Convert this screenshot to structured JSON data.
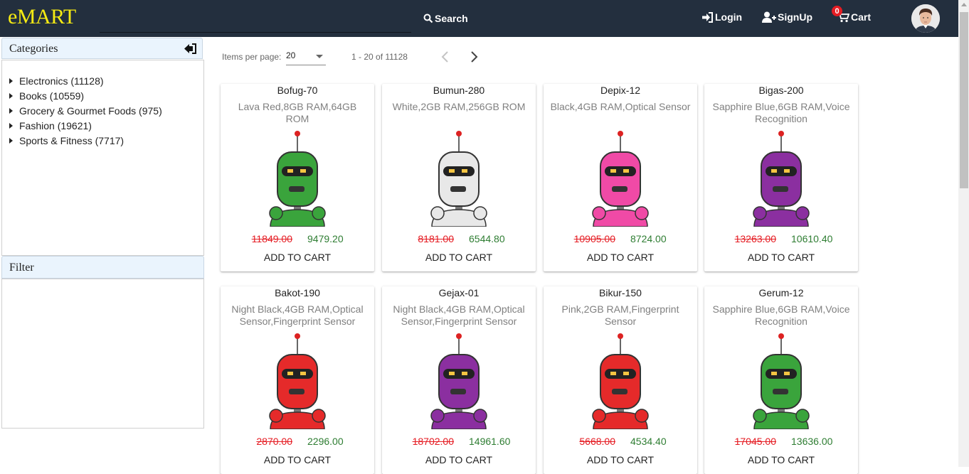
{
  "header": {
    "logo": "eMART",
    "search_label": "Search",
    "login_label": "Login",
    "signup_label": "SignUp",
    "cart_label": "Cart",
    "cart_count": "0"
  },
  "sidebar": {
    "categories_title": "Categories",
    "filter_title": "Filter",
    "categories": [
      {
        "label": "Electronics (11128)"
      },
      {
        "label": "Books (10559)"
      },
      {
        "label": "Grocery & Gourmet Foods (975)"
      },
      {
        "label": "Fashion (19621)"
      },
      {
        "label": "Sports & Fitness (7717)"
      }
    ]
  },
  "paginator": {
    "items_per_page_label": "Items per page:",
    "items_per_page_value": "20",
    "range_label": "1 - 20 of 11128"
  },
  "products": [
    {
      "name": "Bofug-70",
      "desc": "Lava Red,8GB RAM,64GB ROM",
      "old_price": "11849.00",
      "price": "9479.20",
      "add": "ADD TO CART",
      "color": "#3aa43c"
    },
    {
      "name": "Bumun-280",
      "desc": "White,2GB RAM,256GB ROM",
      "old_price": "8181.00",
      "price": "6544.80",
      "add": "ADD TO CART",
      "color": "#e8e8e8"
    },
    {
      "name": "Depix-12",
      "desc": "Black,4GB RAM,Optical Sensor",
      "old_price": "10905.00",
      "price": "8724.00",
      "add": "ADD TO CART",
      "color": "#f04aa6"
    },
    {
      "name": "Bigas-200",
      "desc": "Sapphire Blue,6GB RAM,Voice Recognition",
      "old_price": "13263.00",
      "price": "10610.40",
      "add": "ADD TO CART",
      "color": "#8b2fa0"
    },
    {
      "name": "Bakot-190",
      "desc": "Night Black,4GB RAM,Optical Sensor,Fingerprint Sensor",
      "old_price": "2870.00",
      "price": "2296.00",
      "add": "ADD TO CART",
      "color": "#e52a2a"
    },
    {
      "name": "Gejax-01",
      "desc": "Night Black,4GB RAM,Optical Sensor,Fingerprint Sensor",
      "old_price": "18702.00",
      "price": "14961.60",
      "add": "ADD TO CART",
      "color": "#8b2fa0"
    },
    {
      "name": "Bikur-150",
      "desc": "Pink,2GB RAM,Fingerprint Sensor",
      "old_price": "5668.00",
      "price": "4534.40",
      "add": "ADD TO CART",
      "color": "#e52a2a"
    },
    {
      "name": "Gerum-12",
      "desc": "Sapphire Blue,6GB RAM,Voice Recognition",
      "old_price": "17045.00",
      "price": "13636.00",
      "add": "ADD TO CART",
      "color": "#3aa43c"
    }
  ]
}
